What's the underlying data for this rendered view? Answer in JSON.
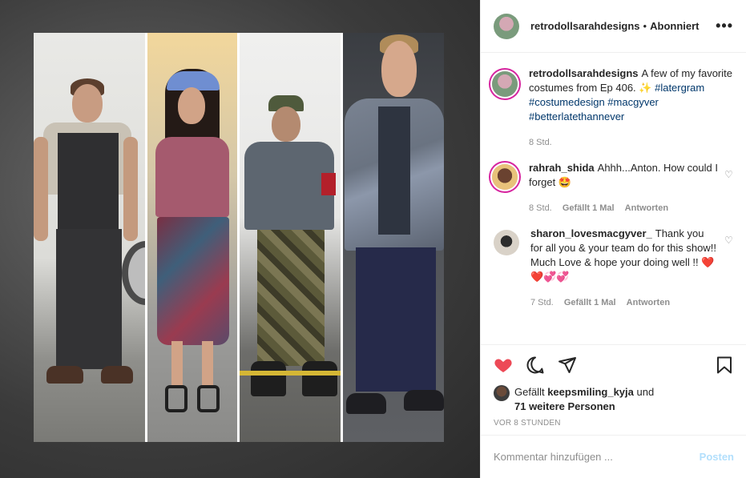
{
  "header": {
    "username": "retrodollsarahdesigns",
    "separator": "•",
    "follow_status": "Abonniert",
    "more_icon": "more-horizontal-icon"
  },
  "caption": {
    "username": "retrodollsarahdesigns",
    "text": "A few of my favorite costumes from Ep 406. ✨",
    "hashtags": [
      "#latergram",
      "#costumedesign",
      "#macgyver",
      "#betterlatethannever"
    ],
    "time": "8 Std."
  },
  "comments": [
    {
      "username": "rahrah_shida",
      "text": "Ahhh...Anton. How could I forget 🤩",
      "time": "8 Std.",
      "likes": "Gefällt 1 Mal",
      "reply": "Antworten"
    },
    {
      "username": "sharon_lovesmacgyver_",
      "text": "Thank you for all you & your team do for this show!! Much Love & hope your doing well !! ❤️❤️💞💞",
      "time": "7 Std.",
      "likes": "Gefällt 1 Mal",
      "reply": "Antworten"
    }
  ],
  "likes": {
    "prefix": "Gefällt",
    "user": "keepsmiling_kyja",
    "connector": "und",
    "others": "71 weitere Personen"
  },
  "posted": "VOR 8 STUNDEN",
  "add_comment": {
    "placeholder": "Kommentar hinzufügen ...",
    "post_label": "Posten"
  },
  "colors": {
    "heart_active": "#ed4956",
    "link": "#00376b",
    "post_disabled": "#b2dffc",
    "muted": "#8e8e8e"
  }
}
